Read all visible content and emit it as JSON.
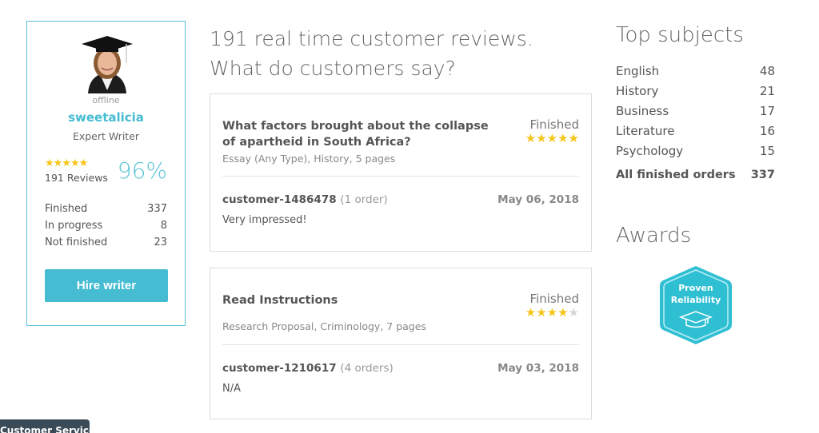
{
  "profile": {
    "status": "offline",
    "username": "sweetalicia",
    "role": "Expert Writer",
    "rating_stars": "★★★★★",
    "reviews_label": "191 Reviews",
    "percent": "96%",
    "stats": [
      {
        "label": "Finished",
        "value": "337"
      },
      {
        "label": "In progress",
        "value": "8"
      },
      {
        "label": "Not finished",
        "value": "23"
      }
    ],
    "hire_button": "Hire writer"
  },
  "reviews": {
    "heading_line1": "191 real time customer reviews.",
    "heading_line2": "What do customers say?",
    "items": [
      {
        "title": "What factors brought about the collapse of apartheid in South Africa?",
        "status": "Finished",
        "rating": 5,
        "meta": "Essay (Any Type), History, 5 pages",
        "customer": "customer-1486478",
        "orders": "(1 order)",
        "date": "May 06, 2018",
        "text": "Very impressed!"
      },
      {
        "title": "Read Instructions",
        "status": "Finished",
        "rating": 4,
        "meta": "Research Proposal, Criminology, 7 pages",
        "customer": "customer-1210617",
        "orders": "(4 orders)",
        "date": "May 03, 2018",
        "text": "N/A"
      }
    ]
  },
  "top_subjects": {
    "heading": "Top subjects",
    "items": [
      {
        "label": "English",
        "value": "48"
      },
      {
        "label": "History",
        "value": "21"
      },
      {
        "label": "Business",
        "value": "17"
      },
      {
        "label": "Literature",
        "value": "16"
      },
      {
        "label": "Psychology",
        "value": "15"
      }
    ],
    "total_label": "All finished orders",
    "total_value": "337"
  },
  "awards": {
    "heading": "Awards",
    "badge_line1": "Proven",
    "badge_line2": "Reliability",
    "badge_icon": "graduation-cap-icon"
  },
  "customer_service": {
    "label": "Customer Service"
  },
  "colors": {
    "accent": "#45bcd2",
    "star": "#f5c518",
    "star_empty": "#d6d6d6",
    "cs_tab": "#3a4a57"
  }
}
